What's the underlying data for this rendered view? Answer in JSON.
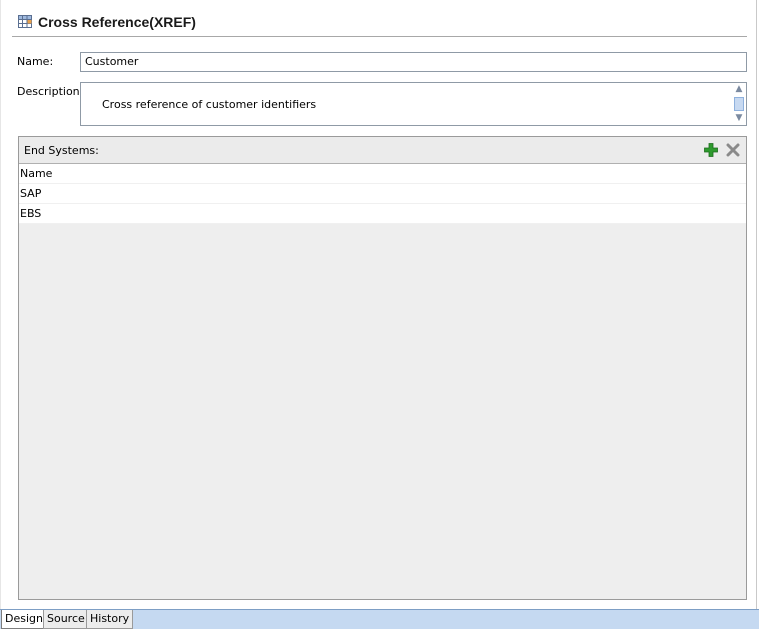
{
  "header": {
    "title": "Cross Reference(XREF)",
    "icon": "table-icon"
  },
  "form": {
    "name_label": "Name:",
    "name_value": "Customer",
    "description_label": "Description:",
    "description_value": "Cross reference of customer identifiers"
  },
  "end_systems": {
    "label": "End Systems:",
    "column_header": "Name",
    "rows": [
      {
        "name": "SAP"
      },
      {
        "name": "EBS"
      }
    ],
    "add_icon": "add-plus-icon",
    "delete_icon": "delete-x-icon",
    "colors": {
      "add": "#2e9a2e",
      "delete": "#8a8a8a"
    }
  },
  "tabs": [
    {
      "label": "Design",
      "active": true
    },
    {
      "label": "Source",
      "active": false
    },
    {
      "label": "History",
      "active": false
    }
  ]
}
